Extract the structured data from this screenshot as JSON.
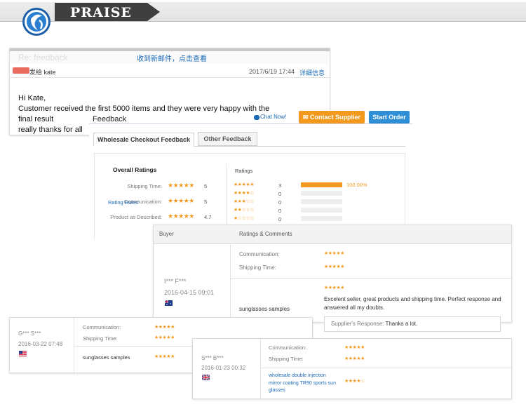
{
  "header": {
    "title": "PRAISE"
  },
  "email": {
    "ghost_subject": "Re: feedback",
    "notice": "收到新邮件，点击查看",
    "from": "发给 kate",
    "date": "2017/6/19  17:44",
    "detail_link": "详细信息",
    "body": [
      "Hi Kate,",
      "Customer received the first 5000 items and they were very happy with the",
      "final result",
      "really thanks for all"
    ]
  },
  "feedback": {
    "title": "Feedback",
    "chat": "Chat Now!",
    "contact_button": "Contact Supplier",
    "order_button": "Start Order",
    "tabs": [
      "Wholesale Checkout Feedback",
      "Other Feedback"
    ],
    "overall_title": "Overall Ratings",
    "overall": [
      {
        "label": "Shipping Time:",
        "stars": "★★★★★",
        "score": "5",
        "value": 5
      },
      {
        "label": "Communication:",
        "stars": "★★★★★",
        "score": "5",
        "value": 5
      },
      {
        "label": "Product as Described:",
        "stars": "★★★★★",
        "score": "4.7",
        "value": 4.7
      }
    ],
    "ratings_title": "Ratings",
    "distribution": [
      {
        "stars": "★★★★★",
        "count": "3",
        "fraction": 1.0,
        "pct": "100.00%"
      },
      {
        "stars": "★★★★☆",
        "count": "0",
        "fraction": 0
      },
      {
        "stars": "★★★☆☆",
        "count": "0",
        "fraction": 0
      },
      {
        "stars": "★★☆☆☆",
        "count": "0",
        "fraction": 0
      },
      {
        "stars": "★☆☆☆☆",
        "count": "0",
        "fraction": 0
      }
    ],
    "rating_rules": "Rating Rules"
  },
  "review_a": {
    "buyer_header": "Buyer",
    "rc_header": "Ratings & Comments",
    "buyer": "I*** F***",
    "date": "2016-04-15 09:01",
    "flag": "australia-flag",
    "communication_label": "Communication:",
    "communication_stars": "★★★★★",
    "shipping_label": "Shipping Time:",
    "shipping_stars": "★★★★★",
    "product": "sunglasses samples",
    "product_stars": "★★★★★",
    "comment": "Excelent seller, great products and shipping time. Perfect response and answered all my doubts.",
    "response_label": "Supplier's Response:",
    "response_text": "Thanks a lot."
  },
  "review_b": {
    "buyer": "G*** S***",
    "date": "2016-03-22 07:48",
    "flag": "usa-flag",
    "communication_label": "Communication:",
    "communication_stars": "★★★★★",
    "shipping_label": "Shipping Time:",
    "shipping_stars": "★★★★★",
    "product": "sunglasses samples",
    "product_stars": "★★★★★"
  },
  "review_c": {
    "buyer": "S*** B***",
    "date": "2016-01-23 00:32",
    "flag": "uk-flag",
    "communication_label": "Communication:",
    "communication_stars": "★★★★★",
    "shipping_label": "Shipping Time:",
    "shipping_stars": "★★★★★",
    "product": "wholesale double injection mirror coating TR90 sports sun glasses",
    "product_stars": "★★★★☆"
  },
  "colors": {
    "accent_orange": "#f39a1e",
    "link_blue": "#1a6ab7",
    "button_blue": "#2e8ed6",
    "header_dark": "#3f3f3f"
  }
}
